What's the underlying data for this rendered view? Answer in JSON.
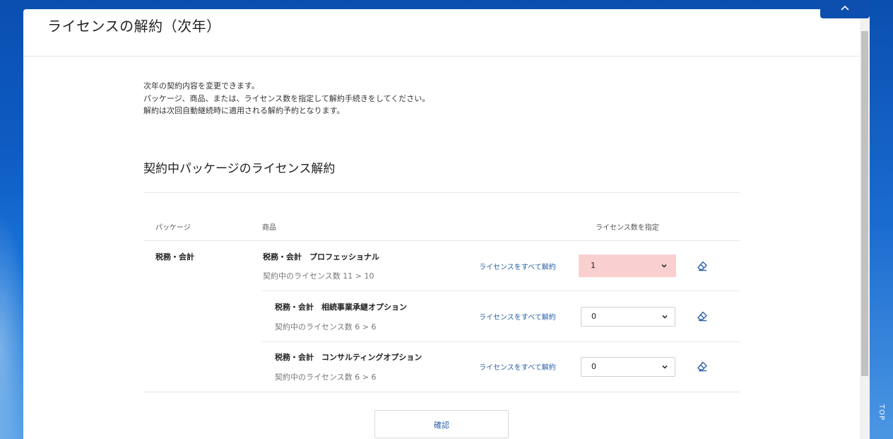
{
  "page": {
    "title": "ライセンスの解約（次年）",
    "intro": [
      "次年の契約内容を変更できます。",
      "パッケージ、商品、または、ライセンス数を指定して解約手続きをしてください。",
      "解約は次回自動継続時に適用される解約予約となります。"
    ],
    "section_title": "契約中パッケージのライセンス解約"
  },
  "table": {
    "headers": {
      "package": "パッケージ",
      "product": "商品",
      "license_count": "ライセンス数を指定"
    },
    "package_name": "税務・会計",
    "rows": [
      {
        "name": "税務・会計　プロフェッショナル",
        "count_text": "契約中のライセンス数 11 > 10",
        "cancel_all": "ライセンスをすべて解約",
        "selected": "1"
      },
      {
        "name": "税務・会計　相続事業承継オプション",
        "count_text": "契約中のライセンス数 6 > 6",
        "cancel_all": "ライセンスをすべて解約",
        "selected": "0"
      },
      {
        "name": "税務・会計　コンサルティングオプション",
        "count_text": "契約中のライセンス数 6 > 6",
        "cancel_all": "ライセンスをすべて解約",
        "selected": "0"
      }
    ]
  },
  "actions": {
    "confirm": "確認"
  },
  "side": {
    "top_label": "TOP"
  },
  "colors": {
    "link": "#2a5fa8",
    "highlight": "#f9cfcf",
    "brand_blue": "#0c4fae"
  },
  "icons": {
    "eraser": "eraser-icon",
    "chevron_down": "chevron-down-icon",
    "chevron_up": "chevron-up-icon"
  }
}
